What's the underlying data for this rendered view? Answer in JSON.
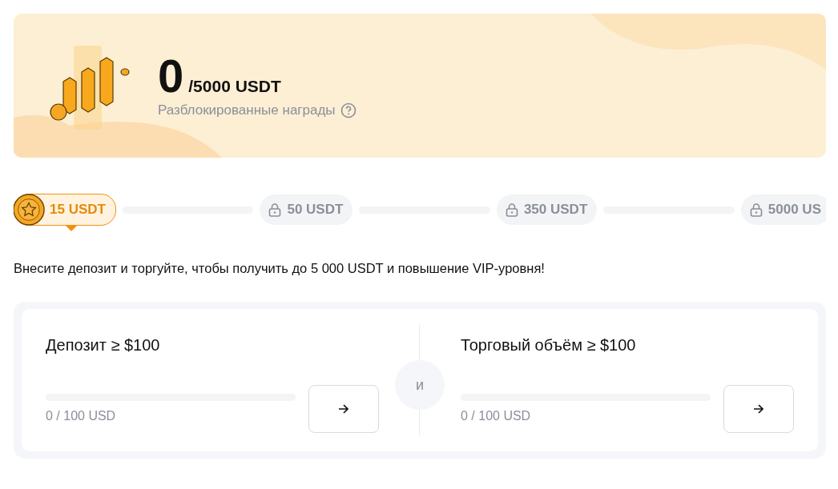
{
  "banner": {
    "amount": "0",
    "total": "/5000 USDT",
    "caption": "Разблокированные награды"
  },
  "milestones": [
    {
      "label": "15 USDT",
      "selected": true,
      "level": 0
    },
    {
      "label": "50 USDT",
      "selected": false,
      "level": 0
    },
    {
      "label": "350 USDT",
      "selected": false,
      "level": 0
    },
    {
      "label": "5000 US",
      "selected": false
    }
  ],
  "headline": "Внесите депозит и торгуйте, чтобы получить до 5 000 USDT и повышение VIP-уровня!",
  "tasks": [
    {
      "title": "Депозит ≥ $100",
      "level": 0,
      "progress": "0 / 100 USD"
    },
    {
      "title": "Торговый объём ≥ $100",
      "level": 0,
      "progress": "0 / 100 USD"
    }
  ],
  "connector": "и"
}
